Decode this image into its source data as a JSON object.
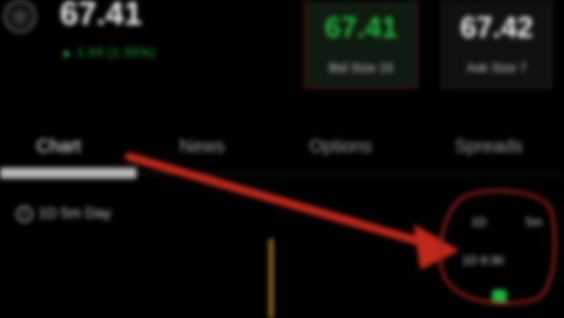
{
  "header": {
    "logo_icon": "company-logo-icon",
    "last_price": "67.41",
    "change_text": "▲ 1.03 (1.55%)"
  },
  "quote": {
    "bid_price": "67.41",
    "bid_size": "Bid Size 15",
    "ask_price": "67.42",
    "ask_size": "Ask Size 7"
  },
  "tabs": [
    {
      "label": "Chart",
      "active": true
    },
    {
      "label": "News",
      "active": false
    },
    {
      "label": "Options",
      "active": false
    },
    {
      "label": "Spreads",
      "active": false
    }
  ],
  "chart": {
    "range_label": "1D 5m Day",
    "mini_left": "1D",
    "mini_right": "5m",
    "mini_time": "1D 9:30"
  },
  "colors": {
    "up_green": "#1fb83c",
    "annotation_red": "#c0281a",
    "candle": "#b8872c"
  }
}
